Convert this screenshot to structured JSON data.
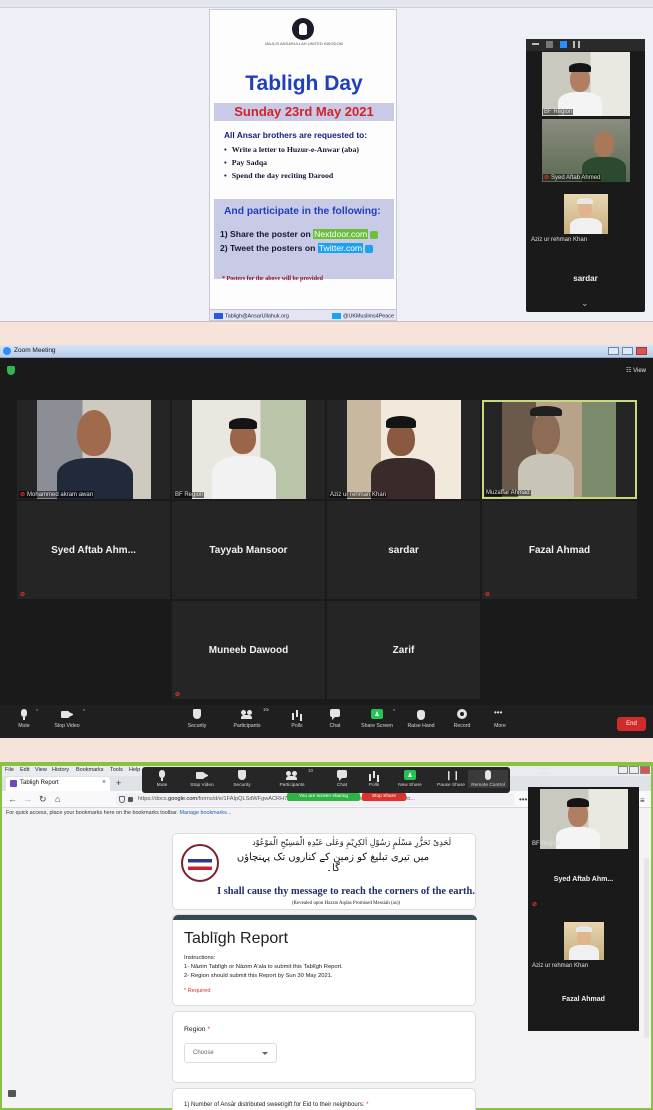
{
  "panel1": {
    "poster": {
      "logo_text": "MAJLIS ANSARULLAH UNITED KINGDOM",
      "title": "Tabligh Day",
      "date": "Sunday 23rd May 2021",
      "request_heading": "All Ansar brothers are requested to:",
      "bullets": [
        "Write a letter to Huzur-e-Anwar (aba)",
        "Pay Sadqa",
        "Spend the day reciting Darood"
      ],
      "participate_heading": "And participate in the following:",
      "step1_prefix": "1) Share the poster on",
      "step1_site": "Nextdoor.com",
      "step2_prefix": "2) Tweet the posters on",
      "step2_site": "Twitter.com",
      "note": "* Posters for the above will be provided",
      "footer_email": "Tabligh@AnsarUllahuk.org",
      "footer_twitter": "@UKMuslims4Peace",
      "colors": {
        "title": "#1f3fbf",
        "date": "#d3212b",
        "band": "#c9cbe6"
      }
    },
    "side_tiles": [
      {
        "name": "BF Region",
        "muted": false
      },
      {
        "name": "Syed Aftab Ahmed",
        "muted": true
      },
      {
        "name": "Aziz ur rehman Khan",
        "muted": false
      },
      {
        "name": "sardar",
        "muted": false
      }
    ]
  },
  "panel2": {
    "window_title": "Zoom Meeting",
    "view_label": "View",
    "video_tiles": [
      {
        "name": "Mohammed akram awan",
        "muted": true
      },
      {
        "name": "BF Region",
        "muted": false
      },
      {
        "name": "Aziz ur rehman Khan",
        "muted": false
      },
      {
        "name": "Muzaffar Ahmad",
        "muted": false
      }
    ],
    "name_tiles": [
      {
        "name": "Syed Aftab Ahm...",
        "muted": true
      },
      {
        "name": "Tayyab Mansoor",
        "muted": false
      },
      {
        "name": "sardar",
        "muted": false
      },
      {
        "name": "Fazal Ahmad",
        "muted": true
      },
      {
        "name": "Muneeb Dawood",
        "muted": true
      },
      {
        "name": "Zarif",
        "muted": false
      }
    ],
    "toolbar": {
      "mute": "Mute",
      "stop_video": "Stop Video",
      "security": "Security",
      "participants": "Participants",
      "participants_count": "10",
      "polls": "Polls",
      "chat": "Chat",
      "share_screen": "Share Screen",
      "raise_hand": "Raise Hand",
      "record": "Record",
      "more": "More",
      "end": "End"
    }
  },
  "panel3": {
    "menu": [
      "File",
      "Edit",
      "View",
      "History",
      "Bookmarks",
      "Tools",
      "Help"
    ],
    "tab_title": "Tabligh Report",
    "url_prefix": "https://docs.",
    "url_domain": "google.com",
    "url_rest": "/forms/d/e/1FAIpQLSdWFgwACRH75vzrv7nBkpJyNl_9N7PUCgUWlZ/Ig3T9bQ/viewfo...",
    "bookmarks_hint": "For quick access, place your bookmarks here on the bookmarks toolbar.",
    "bookmarks_link": "Manage bookmarks...",
    "zoom_controls": {
      "mute": "Mute",
      "stop_video": "Stop Video",
      "security": "Security",
      "participants": "Participants",
      "participants_count": "10",
      "chat": "Chat",
      "polls": "Polls",
      "new_share": "New Share",
      "pause_share": "Pause Share",
      "remote_control": "Remote Control",
      "more": "More",
      "sharing_banner": "You are screen sharing",
      "stop_share": "Stop Share"
    },
    "form": {
      "banner_urdu_top": "لَحَدِیْ تَحَزُّرِ مَسْلَمٍ رَسُوْلِ اَلکِرِیْمِ وَعَلٰی عَبْدِہِ الْمَسِیْحِ الْمَوْعُوْد",
      "banner_urdu_main": "میں تیری تبلیغ کو زمین کے کناروں تک پہنچاؤں گا۔",
      "banner_english": "I shall cause thy message to reach the corners of the earth.",
      "banner_revealed": "(Revealed upon Hazrat Aqdas Promised Messiah (as))",
      "title": "Tablīgh Report",
      "instructions_heading": "Instructions:",
      "instruction1": "1- Nāzim Tablīgh or Nāzim A'ala to submit this Tablīgh Report.",
      "instruction2": "2- Region should submit this Report by Sun 30 May 2021.",
      "required_note": "* Required",
      "q1_label": "Region",
      "q1_placeholder": "Choose",
      "q2_label": "1) Number of Ansār distributed sweet/gift for Eid to their neighbours:"
    },
    "side_tiles": [
      {
        "name": "BF Region",
        "muted": false
      },
      {
        "name": "Syed Aftab Ahm...",
        "muted": true
      },
      {
        "name": "Aziz ur rehman Khan",
        "muted": false
      },
      {
        "name": "Fazal Ahmad",
        "muted": false
      }
    ]
  }
}
